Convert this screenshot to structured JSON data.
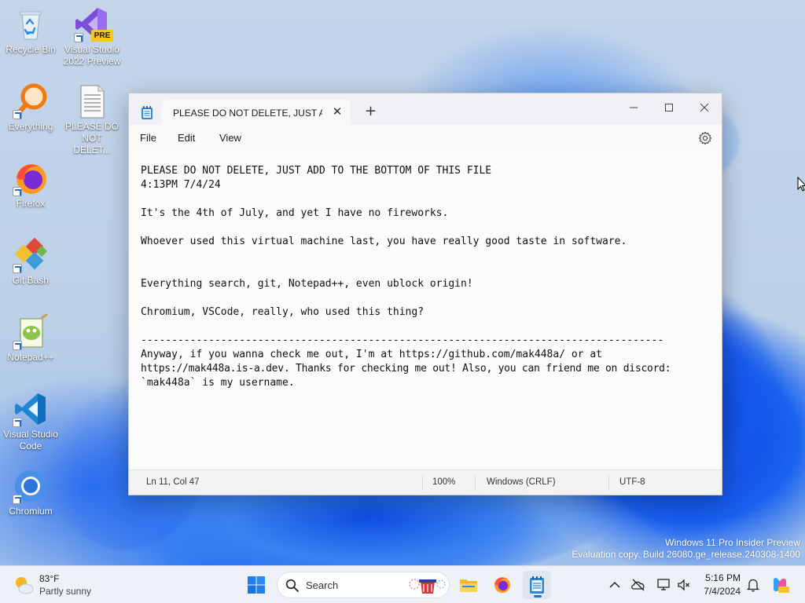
{
  "desktop": {
    "icons": [
      {
        "label": "Recycle Bin"
      },
      {
        "label": "Visual Studio 2022 Preview",
        "badge": "PRE"
      },
      {
        "label": "Everything"
      },
      {
        "label": "PLEASE DO NOT DELET..."
      },
      {
        "label": "Firefox"
      },
      {
        "label": "Git Bash"
      },
      {
        "label": "Notepad++"
      },
      {
        "label": "Visual Studio Code"
      },
      {
        "label": "Chromium"
      }
    ],
    "watermark": {
      "line1": "Windows 11 Pro Insider Preview",
      "line2": "Evaluation copy. Build 26080.ge_release.240308-1400"
    }
  },
  "notepad": {
    "tab_title": "PLEASE DO NOT DELETE, JUST ADD TO THE BOTTOM OF THIS FILE",
    "tab_close": "✕",
    "new_tab": "+",
    "menu": {
      "file": "File",
      "edit": "Edit",
      "view": "View"
    },
    "content": [
      "PLEASE DO NOT DELETE, JUST ADD TO THE BOTTOM OF THIS FILE",
      "4:13PM 7/4/24",
      "",
      "It's the 4th of July, and yet I have no fireworks.",
      "",
      "Whoever used this virtual machine last, you have really good taste in software.",
      "",
      "",
      "Everything search, git, Notepad++, even ublock origin!",
      "",
      "Chromium, VSCode, really, who used this thing?",
      "",
      "-------------------------------------------------------------------------------------",
      "Anyway, if you wanna check me out, I'm at https://github.com/mak448a/ or at",
      "https://mak448a.is-a.dev. Thanks for checking me out! Also, you can friend me on discord:",
      "`mak448a` is my username."
    ],
    "status": {
      "position": "Ln 11, Col 47",
      "zoom": "100%",
      "line_ending": "Windows (CRLF)",
      "encoding": "UTF-8"
    }
  },
  "taskbar": {
    "weather": {
      "temp": "83°F",
      "desc": "Partly sunny"
    },
    "search_placeholder": "Search",
    "clock": {
      "time": "5:16 PM",
      "date": "7/4/2024"
    }
  }
}
